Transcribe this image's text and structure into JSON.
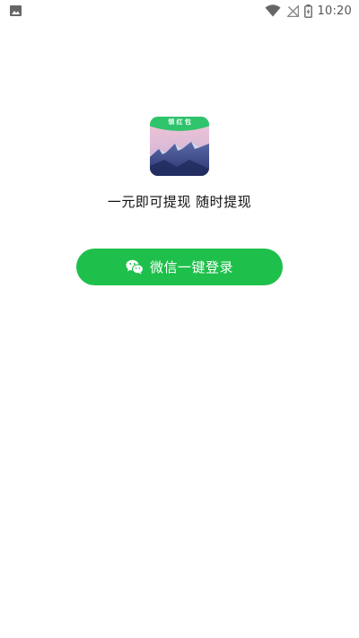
{
  "status_bar": {
    "time": "10:20",
    "icons": [
      "gallery-icon",
      "wifi-icon",
      "no-signal-icon",
      "battery-charging-icon"
    ]
  },
  "app": {
    "icon": "mountain-app-icon",
    "icon_banner_text": "领 红 包",
    "slogan": "一元即可提现 随时提现"
  },
  "login_button": {
    "label": "微信一键登录",
    "icon": "wechat-icon",
    "color": "#1ec04b"
  }
}
